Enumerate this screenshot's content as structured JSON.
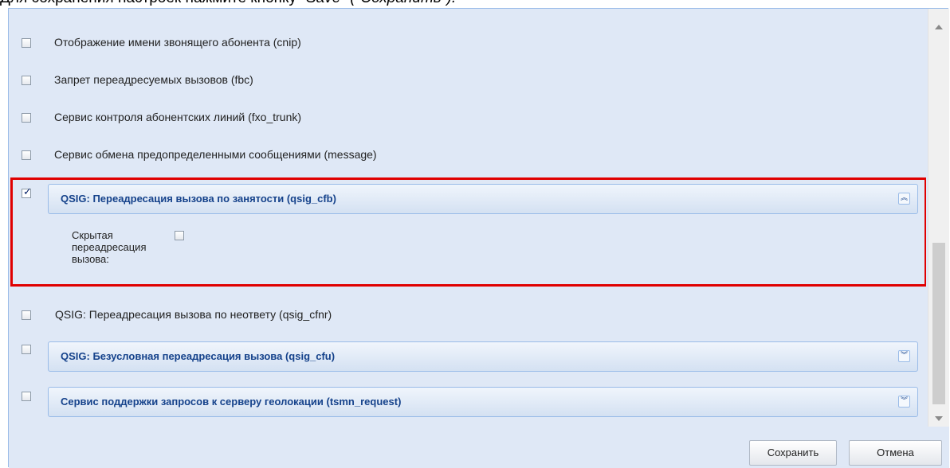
{
  "caption": {
    "prefix": "Для сохранения настроек нажмите кнопку ",
    "button_en": "\"Save\"",
    "paren_open": " (\"",
    "button_ru": "Сохранить",
    "suffix": "\")."
  },
  "options": [
    {
      "label": "Отображение имени звонящего абонента (cnip)",
      "checked": false
    },
    {
      "label": "Запрет переадресуемых вызовов (fbc)",
      "checked": false
    },
    {
      "label": "Сервис контроля абонентских линий (fxo_trunk)",
      "checked": false
    },
    {
      "label": "Сервис обмена предопределенными сообщениями (message)",
      "checked": false
    }
  ],
  "qsig_cfb": {
    "title": "QSIG: Переадресация вызова по занятости (qsig_cfb)",
    "checked": true,
    "toggle_icon": "collapse-icon",
    "hidden_forward_label": "Скрытая переадресация вызова:",
    "hidden_forward_checked": false
  },
  "qsig_cfnr": {
    "label": "QSIG: Переадресация вызова по неответу (qsig_cfnr)",
    "checked": false
  },
  "qsig_cfu": {
    "title": "QSIG: Безусловная переадресация вызова (qsig_cfu)",
    "checked": false,
    "toggle_icon": "expand-icon"
  },
  "tsmn_request": {
    "title": "Сервис поддержки запросов к серверу геолокации (tsmn_request)",
    "checked": false,
    "toggle_icon": "expand-icon"
  },
  "buttons": {
    "save": "Сохранить",
    "cancel": "Отмена"
  },
  "colors": {
    "panel_bg": "#dfe8f6",
    "header_text": "#15428b",
    "highlight": "#e00000"
  }
}
